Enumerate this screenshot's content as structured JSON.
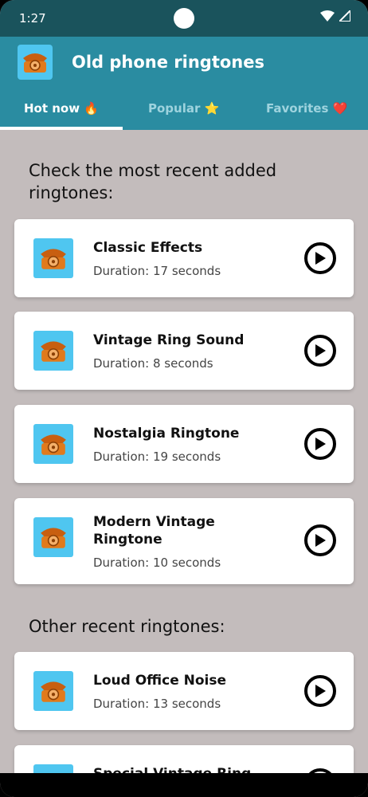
{
  "status": {
    "time": "1:27"
  },
  "app": {
    "title": "Old phone ringtones"
  },
  "tabs": [
    {
      "label": "Hot now 🔥",
      "selected": true
    },
    {
      "label": "Popular ⭐",
      "selected": false
    },
    {
      "label": "Favorites ❤️",
      "selected": false
    }
  ],
  "sections": {
    "recent_added": "Check the most recent added ringtones:",
    "other_recent": "Other recent ringtones:"
  },
  "ringtones": [
    {
      "name": "Classic Effects",
      "duration": "Duration: 17 seconds"
    },
    {
      "name": "Vintage Ring Sound",
      "duration": "Duration: 8 seconds"
    },
    {
      "name": "Nostalgia Ringtone",
      "duration": "Duration: 19 seconds"
    },
    {
      "name": "Modern Vintage Ringtone",
      "duration": "Duration: 10 seconds"
    }
  ],
  "other_ringtones": [
    {
      "name": "Loud Office Noise",
      "duration": "Duration: 13 seconds"
    },
    {
      "name": "Special Vintage Ring",
      "duration": ""
    }
  ],
  "icons": {
    "phone": "rotary-phone-icon",
    "play": "play-icon",
    "wifi": "wifi-icon",
    "signal": "signal-icon"
  },
  "colors": {
    "status_bar": "#1a535c",
    "app_bar": "#2a8ca1",
    "background": "#c3bcbc",
    "thumb": "#4fc6f0"
  }
}
